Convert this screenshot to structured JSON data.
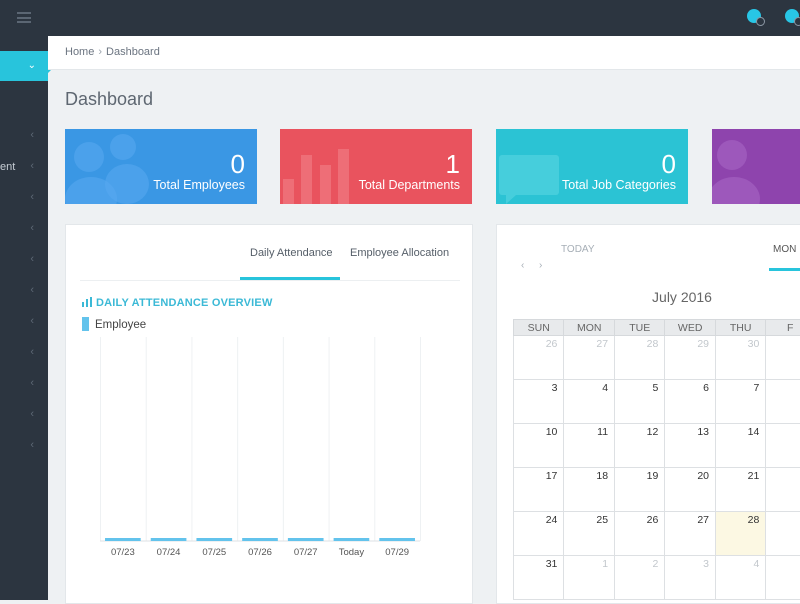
{
  "breadcrumb": {
    "home": "Home",
    "separator": "›",
    "current": "Dashboard"
  },
  "page_title": "Dashboard",
  "sidebar": {
    "items": [
      {
        "label": ""
      },
      {
        "label": "ent"
      },
      {
        "label": ""
      },
      {
        "label": ""
      },
      {
        "label": ""
      },
      {
        "label": ""
      },
      {
        "label": ""
      },
      {
        "label": ""
      },
      {
        "label": ""
      },
      {
        "label": ""
      },
      {
        "label": ""
      }
    ]
  },
  "stats": [
    {
      "value": "0",
      "label": "Total Employees",
      "color": "#3a97e4",
      "icon": "users-icon"
    },
    {
      "value": "1",
      "label": "Total Departments",
      "color": "#e9535e",
      "icon": "bar-chart-icon"
    },
    {
      "value": "0",
      "label": "Total Job Categories",
      "color": "#2bc3d4",
      "icon": "chat-icon"
    },
    {
      "value": "",
      "label": "",
      "color": "#8e44ad",
      "icon": "users-icon"
    }
  ],
  "attendance_card": {
    "tabs": [
      "Daily Attendance",
      "Employee Allocation"
    ],
    "active_tab": "Daily Attendance",
    "chart_title": "DAILY ATTENDANCE OVERVIEW",
    "legend": "Employee"
  },
  "chart_data": {
    "type": "bar",
    "title": "DAILY ATTENDANCE OVERVIEW",
    "categories": [
      "07/23",
      "07/24",
      "07/25",
      "07/26",
      "07/27",
      "Today",
      "07/29"
    ],
    "series": [
      {
        "name": "Employee",
        "values": [
          0,
          0,
          0,
          0,
          0,
          0,
          0
        ]
      }
    ],
    "grid": true,
    "legend_position": "top-left",
    "color": "#63c3ec"
  },
  "calendar": {
    "nav_prev": "‹",
    "nav_next": "›",
    "today_label": "TODAY",
    "view_label": "MON",
    "title": "July 2016",
    "weekdays": [
      "SUN",
      "MON",
      "TUE",
      "WED",
      "THU",
      "F"
    ],
    "weeks": [
      [
        "26",
        "27",
        "28",
        "29",
        "30",
        ""
      ],
      [
        "3",
        "4",
        "5",
        "6",
        "7",
        ""
      ],
      [
        "10",
        "11",
        "12",
        "13",
        "14",
        ""
      ],
      [
        "17",
        "18",
        "19",
        "20",
        "21",
        ""
      ],
      [
        "24",
        "25",
        "26",
        "27",
        "28",
        ""
      ],
      [
        "31",
        "1",
        "2",
        "3",
        "4",
        ""
      ]
    ]
  }
}
